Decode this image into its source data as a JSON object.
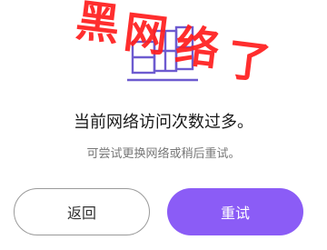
{
  "overlay": {
    "chars": [
      "黑",
      "网",
      "络",
      "了"
    ]
  },
  "error": {
    "message": "当前网络访问次数过多。",
    "hint": "可尝试更换网络或稍后重试。"
  },
  "actions": {
    "back_label": "返回",
    "retry_label": "重试"
  },
  "colors": {
    "accent": "#8b5cf6",
    "overlay_red": "#ff1f1f",
    "illustration_stroke": "#6d5bd0"
  },
  "icons": {
    "illustration": "network-blocked-illustration"
  }
}
